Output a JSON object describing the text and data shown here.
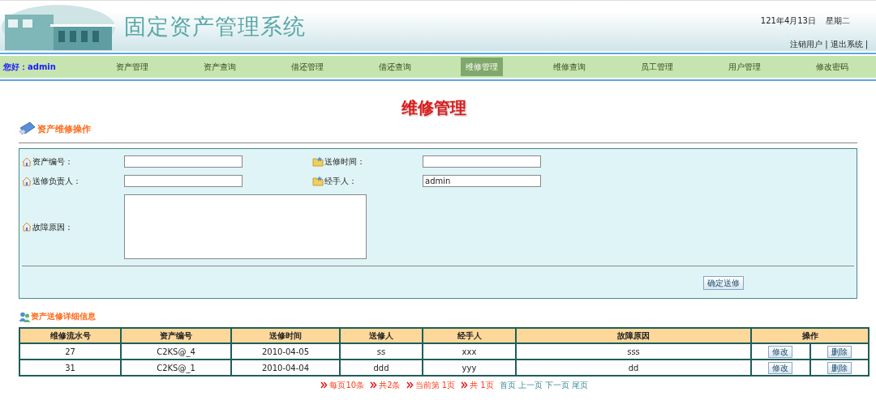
{
  "header": {
    "title": "固定资产管理系统",
    "date": "121年4月13日",
    "weekday": "星期二",
    "links": [
      "注销用户",
      "退出系统"
    ],
    "separator": "|"
  },
  "nav": {
    "greeting": "您好：",
    "user": "admin",
    "items": [
      {
        "label": "资产管理",
        "selected": false
      },
      {
        "label": "资产查询",
        "selected": false
      },
      {
        "label": "借还管理",
        "selected": false
      },
      {
        "label": "借还查询",
        "selected": false
      },
      {
        "label": "维修管理",
        "selected": true
      },
      {
        "label": "维修查询",
        "selected": false
      },
      {
        "label": "员工管理",
        "selected": false
      },
      {
        "label": "用户管理",
        "selected": false
      },
      {
        "label": "修改密码",
        "selected": false
      }
    ]
  },
  "page_title": "维修管理",
  "form": {
    "heading": "资产维修操作",
    "fields": [
      {
        "label": "资产编号：",
        "kind": "text"
      },
      {
        "label": "送修时间：",
        "kind": "text"
      },
      {
        "label": "送修负责人：",
        "kind": "text"
      },
      {
        "label": "经手人：",
        "kind": "text",
        "value": "admin"
      },
      {
        "label": "故障原因：",
        "kind": "textarea"
      }
    ],
    "submit": "确定送修"
  },
  "table": {
    "heading": "资产送修详细信息",
    "columns": [
      "维修流水号",
      "资产编号",
      "送修时间",
      "送修人",
      "经手人",
      "故障原因",
      "操作"
    ],
    "rows": [
      {
        "cells": [
          "27",
          "C2KS@_4",
          "2010-04-05",
          "ss",
          "xxx",
          "sss"
        ],
        "actions": [
          "修改",
          "删除"
        ]
      },
      {
        "cells": [
          "31",
          "C2KS@_1",
          "2010-04-04",
          "ddd",
          "yyy",
          "dd"
        ],
        "actions": [
          "修改",
          "删除"
        ]
      }
    ]
  },
  "pager": [
    {
      "text": "每页10条",
      "kind": "info"
    },
    {
      "text": "共2条",
      "kind": "info"
    },
    {
      "text": "当前第 1页",
      "kind": "info"
    },
    {
      "text": "共 1页",
      "kind": "info"
    },
    {
      "text": "首页",
      "kind": "link"
    },
    {
      "text": "上一页",
      "kind": "link"
    },
    {
      "text": "下一页",
      "kind": "link"
    },
    {
      "text": "尾页",
      "kind": "link"
    }
  ]
}
